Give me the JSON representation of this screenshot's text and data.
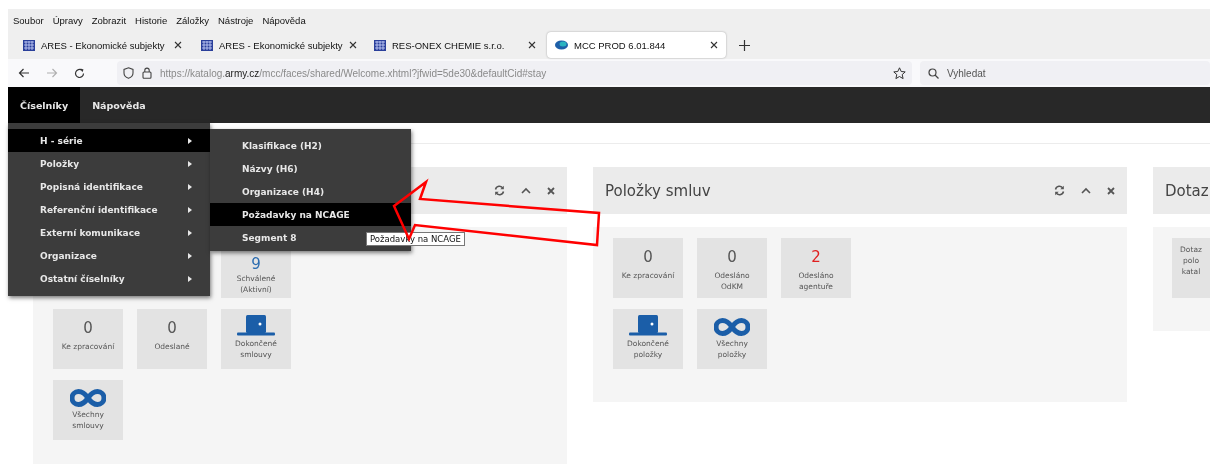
{
  "browser_menu": [
    "Soubor",
    "Úpravy",
    "Zobrazit",
    "Historie",
    "Záložky",
    "Nástroje",
    "Nápověda"
  ],
  "tabs": [
    {
      "title": "ARES - Ekonomické subjekty",
      "selected": false
    },
    {
      "title": "ARES - Ekonomické subjekty",
      "selected": false
    },
    {
      "title": "RES-ONEX CHEMIE s.r.o.",
      "selected": false
    },
    {
      "title": "MCC PROD 6.01.844",
      "selected": true
    }
  ],
  "forward_disabled": true,
  "address_bar": {
    "url": "https://katalog.**army.cz**/mcc/faces/shared/Welcome.xhtml?jfwid=5de30&defaultCid#stay"
  },
  "search": {
    "placeholder": "Vyhledat"
  },
  "app_nav": [
    {
      "label": "Číselníky",
      "selected": true
    },
    {
      "label": "Nápověda",
      "selected": false
    }
  ],
  "menu": {
    "items": [
      {
        "label": "H - série",
        "selected": true
      },
      {
        "label": "Položky",
        "selected": false
      },
      {
        "label": "Popisná identifikace",
        "selected": false
      },
      {
        "label": "Referenční identifikace",
        "selected": false
      },
      {
        "label": "Externí komunikace",
        "selected": false
      },
      {
        "label": "Organizace",
        "selected": false
      },
      {
        "label": "Ostatní číselníky",
        "selected": false
      }
    ],
    "submenu": [
      {
        "label": "Klasifikace (H2)",
        "selected": false
      },
      {
        "label": "Názvy (H6)",
        "selected": false
      },
      {
        "label": "Organizace (H4)",
        "selected": false
      },
      {
        "label": "Požadavky na NCAGE",
        "selected": true
      },
      {
        "label": "Segment 8",
        "selected": false
      }
    ],
    "tooltip": "Požadavky na NCAGE"
  },
  "panels": [
    {
      "tiles": [
        {
          "kind": "count",
          "value": "9",
          "color": "#2b6cb0",
          "label": "Schválené (Aktivní)"
        },
        {
          "kind": "count",
          "value": "0",
          "color": "#555555",
          "label": "Ke zpracování"
        },
        {
          "kind": "count",
          "value": "0",
          "color": "#555555",
          "label": "Odeslané"
        },
        {
          "kind": "door",
          "label": "Dokončené smlouvy"
        },
        {
          "kind": "infinity",
          "label": "Všechny smlouvy"
        }
      ]
    },
    {
      "title": "Položky smluv",
      "tiles": [
        {
          "kind": "count",
          "value": "0",
          "color": "#555555",
          "label": "Ke zpracování"
        },
        {
          "kind": "count",
          "value": "0",
          "color": "#555555",
          "label": "Odesláno OdKM"
        },
        {
          "kind": "count",
          "value": "2",
          "color": "#e02020",
          "label": "Odesláno agentuře"
        },
        {
          "kind": "door",
          "label": "Dokončené položky"
        },
        {
          "kind": "infinity",
          "label": "Všechny položky"
        }
      ]
    },
    {
      "title": "Dotaz",
      "tiles": [
        {
          "kind": "text",
          "label": "Dotaz\npolo\nkatal"
        }
      ]
    }
  ]
}
